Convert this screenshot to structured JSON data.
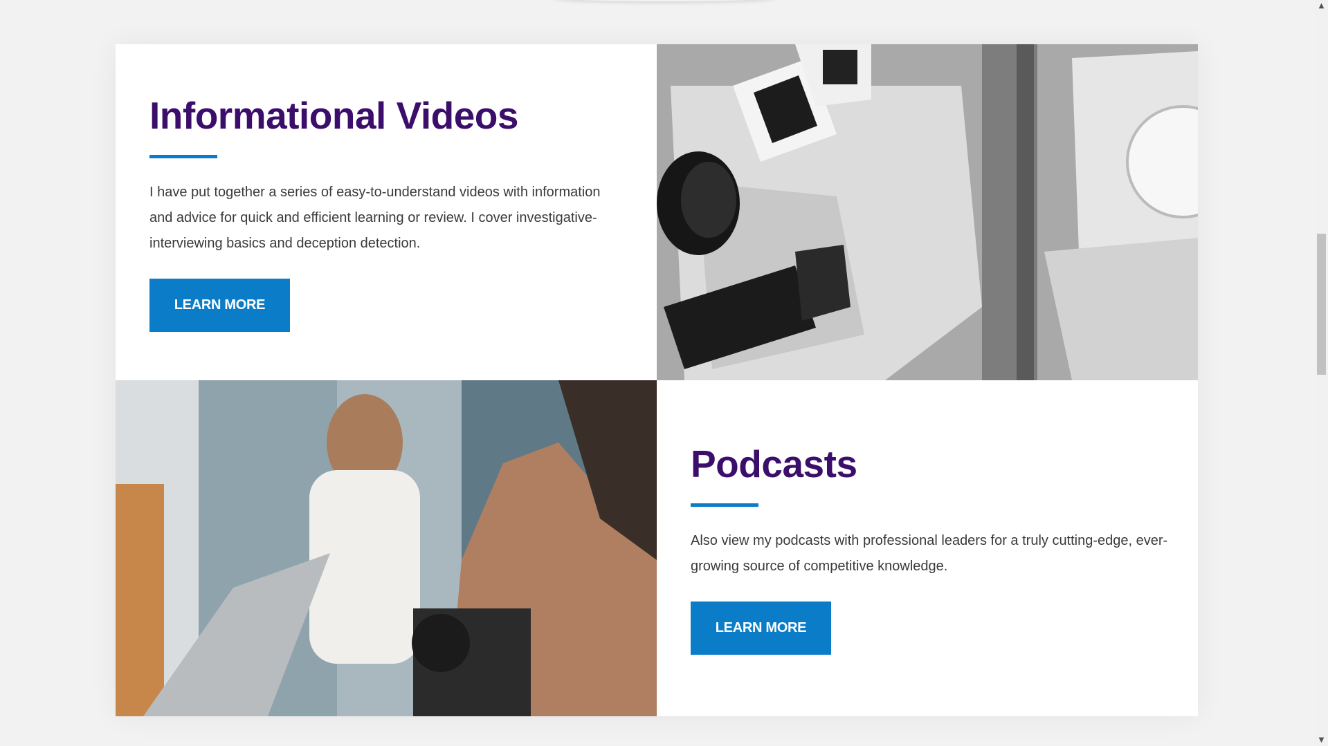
{
  "cards": [
    {
      "title": "Informational Videos",
      "text": "I have put together a series of easy-to-understand videos with information and advice for quick and efficient learning or review. I cover investigative-interviewing basics and deception detection.",
      "button_label": "LEARN MORE"
    },
    {
      "title": "Podcasts",
      "text": "Also view my podcasts with professional leaders for a truly cutting-edge, ever-growing source of competitive knowledge.",
      "button_label": "LEARN MORE"
    }
  ],
  "colors": {
    "title": "#3b0e6b",
    "accent": "#0a7cc8",
    "background": "#f2f2f2",
    "card_bg": "#ffffff"
  },
  "scrollbar": {
    "up_icon": "triangle-up-icon",
    "down_icon": "triangle-down-icon",
    "up_glyph": "▲",
    "down_glyph": "▼"
  }
}
